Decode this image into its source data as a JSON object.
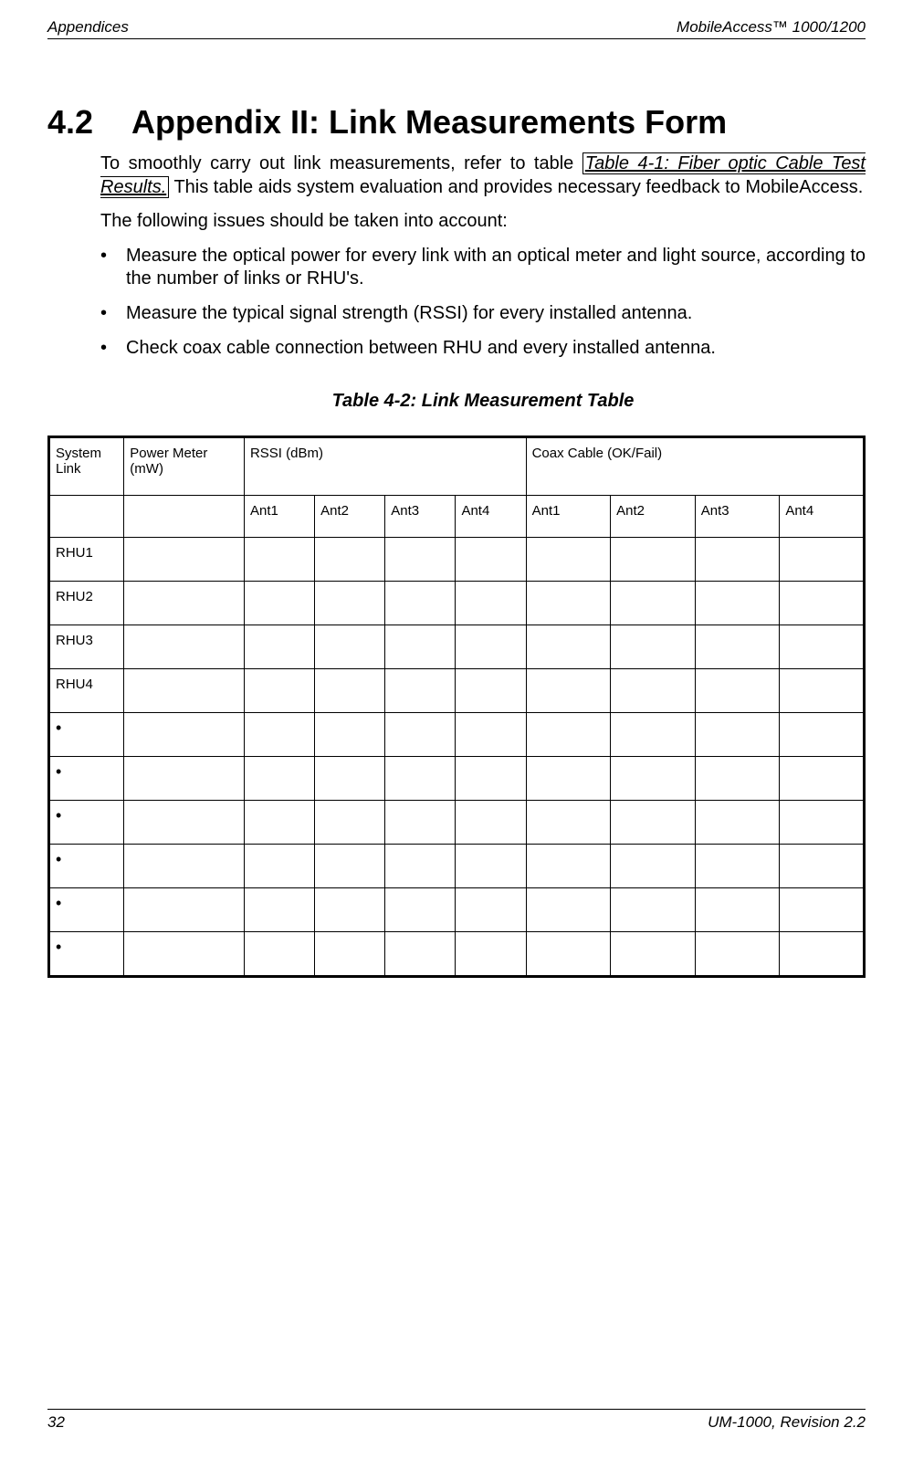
{
  "header": {
    "left": "Appendices",
    "right": "MobileAccess™  1000/1200"
  },
  "section": {
    "number": "4.2",
    "title": "Appendix II: Link Measurements Form"
  },
  "para1_a": "To smoothly carry out link measurements, refer to table ",
  "para1_link": "Table 4-1: Fiber optic Cable Test Results.",
  "para1_b": " This table aids system evaluation and provides necessary feedback to MobileAccess.",
  "para2": "The following issues should be taken into account:",
  "bullets": [
    "Measure the optical power for every link with an optical meter and light source, according to the number of links or RHU's.",
    "Measure the typical signal strength (RSSI) for every installed antenna.",
    "Check coax cable connection between RHU and every installed antenna."
  ],
  "table_caption": "Table 4-2: Link Measurement Table",
  "table": {
    "headers": {
      "system_link": "System Link",
      "power_meter": "Power Meter (mW)",
      "rssi": "RSSI (dBm)",
      "coax": "Coax Cable (OK/Fail)",
      "ant1": "Ant1",
      "ant2": "Ant2",
      "ant3": "Ant3",
      "ant4": "Ant4"
    },
    "rows": [
      "RHU1",
      "RHU2",
      "RHU3",
      "RHU4",
      "•",
      "•",
      "•",
      "•",
      "•",
      "•"
    ]
  },
  "footer": {
    "left": "32",
    "right": "UM-1000, Revision 2.2"
  }
}
